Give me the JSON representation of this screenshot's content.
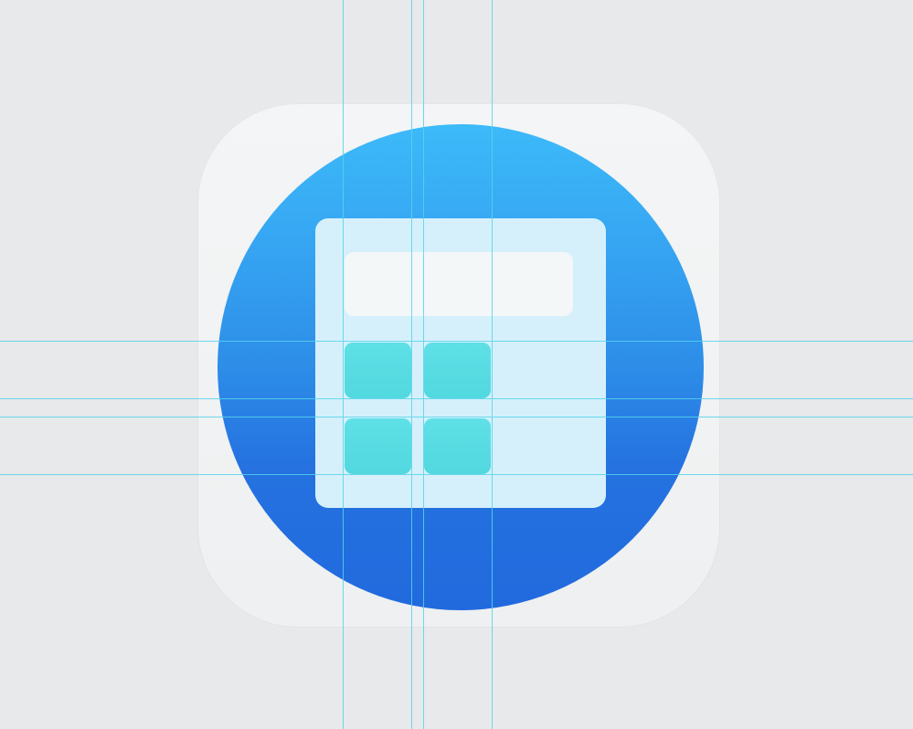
{
  "canvas": {
    "background_color": "#e8e9ea"
  },
  "icon": {
    "name": "calculator-icon",
    "colors": {
      "tile": "#f3f5f6",
      "circle_top": "#3cbaf9",
      "circle_bottom": "#216ade",
      "calculator_body": "#d6f0fb",
      "display": "#f3f7f8",
      "keys": "#58dce2",
      "guide_lines": "#55d4ec"
    },
    "keys": [
      {
        "row": 1,
        "col": 1
      },
      {
        "row": 1,
        "col": 2
      },
      {
        "row": 2,
        "col": 1
      },
      {
        "row": 2,
        "col": 2
      }
    ]
  }
}
